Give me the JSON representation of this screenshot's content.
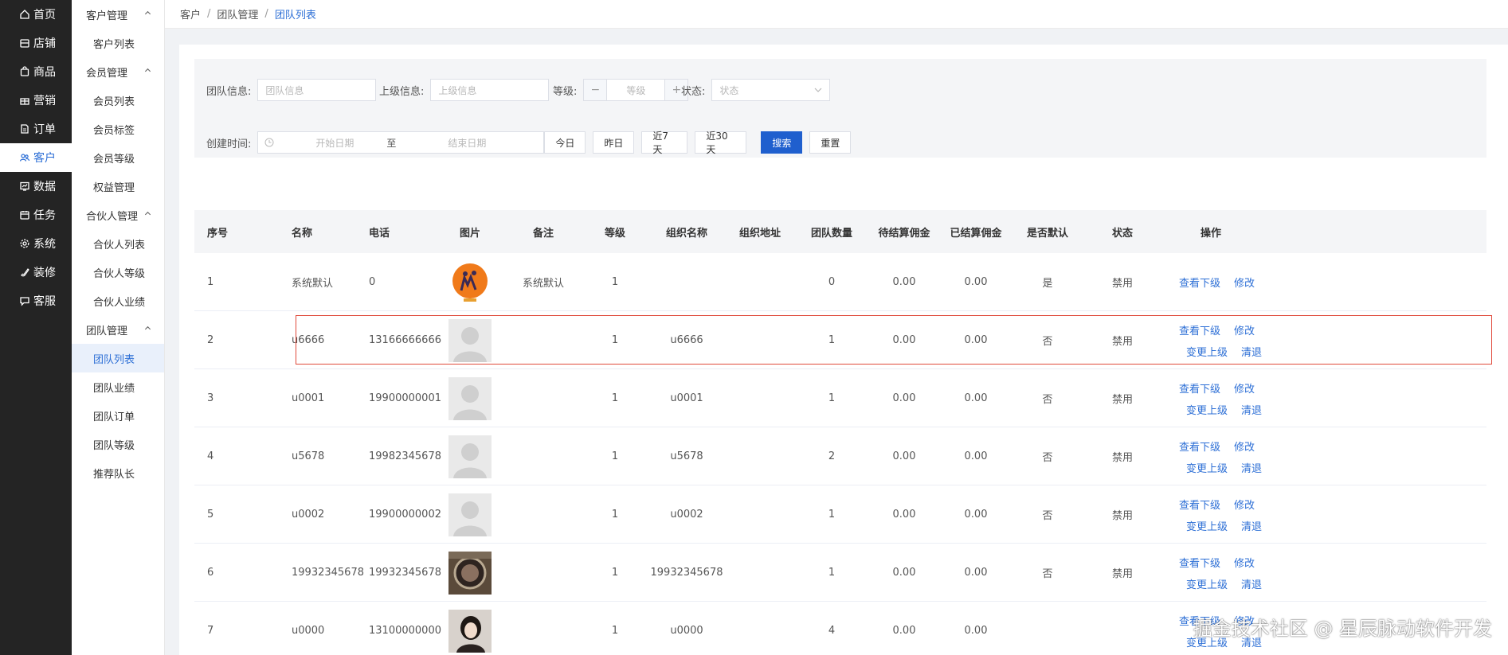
{
  "nav_primary": [
    {
      "label": "首页",
      "icon": "home-icon"
    },
    {
      "label": "店铺",
      "icon": "shop-icon"
    },
    {
      "label": "商品",
      "icon": "bag-icon"
    },
    {
      "label": "营销",
      "icon": "gift-icon"
    },
    {
      "label": "订单",
      "icon": "document-icon"
    },
    {
      "label": "客户",
      "icon": "users-icon",
      "active": true
    },
    {
      "label": "数据",
      "icon": "chart-icon"
    },
    {
      "label": "任务",
      "icon": "calendar-icon"
    },
    {
      "label": "系统",
      "icon": "gear-icon"
    },
    {
      "label": "装修",
      "icon": "brush-icon"
    },
    {
      "label": "客服",
      "icon": "chat-icon"
    }
  ],
  "nav_secondary": [
    {
      "group": "客户管理",
      "items": [
        "客户列表"
      ]
    },
    {
      "group": "会员管理",
      "items": [
        "会员列表",
        "会员标签",
        "会员等级",
        "权益管理"
      ]
    },
    {
      "group": "合伙人管理",
      "items": [
        "合伙人列表",
        "合伙人等级",
        "合伙人业绩"
      ]
    },
    {
      "group": "团队管理",
      "items": [
        "团队列表",
        "团队业绩",
        "团队订单",
        "团队等级",
        "推荐队长"
      ]
    }
  ],
  "breadcrumb": {
    "a": "客户",
    "b": "团队管理",
    "c": "团队列表",
    "sep": "/"
  },
  "filter": {
    "team_label": "团队信息:",
    "team_placeholder": "团队信息",
    "parent_label": "上级信息:",
    "parent_placeholder": "上级信息",
    "level_label": "等级:",
    "level_placeholder": "等级",
    "minus": "−",
    "plus": "+",
    "status_label": "状态:",
    "status_placeholder": "状态",
    "date_label": "创建时间:",
    "start_placeholder": "开始日期",
    "to": "至",
    "end_placeholder": "结束日期",
    "today": "今日",
    "yesterday": "昨日",
    "last7": "近7天",
    "last30": "近30天",
    "search": "搜索",
    "reset": "重置"
  },
  "table": {
    "headers": [
      "序号",
      "名称",
      "电话",
      "图片",
      "备注",
      "等级",
      "组织名称",
      "组织地址",
      "团队数量",
      "待结算佣金",
      "已结算佣金",
      "是否默认",
      "状态",
      "操作"
    ],
    "rows": [
      {
        "no": "1",
        "name": "系统默认",
        "phone": "0",
        "note": "系统默认",
        "level": "1",
        "org": "",
        "addr": "",
        "count": "0",
        "pending": "0.00",
        "settled": "0.00",
        "default": "是",
        "status": "禁用",
        "avatar": "logo"
      },
      {
        "no": "2",
        "name": "u6666",
        "phone": "13166666666",
        "note": "",
        "level": "1",
        "org": "u6666",
        "addr": "",
        "count": "1",
        "pending": "0.00",
        "settled": "0.00",
        "default": "否",
        "status": "禁用",
        "avatar": "placeholder"
      },
      {
        "no": "3",
        "name": "u0001",
        "phone": "19900000001",
        "note": "",
        "level": "1",
        "org": "u0001",
        "addr": "",
        "count": "1",
        "pending": "0.00",
        "settled": "0.00",
        "default": "否",
        "status": "禁用",
        "avatar": "placeholder"
      },
      {
        "no": "4",
        "name": "u5678",
        "phone": "19982345678",
        "note": "",
        "level": "1",
        "org": "u5678",
        "addr": "",
        "count": "2",
        "pending": "0.00",
        "settled": "0.00",
        "default": "否",
        "status": "禁用",
        "avatar": "placeholder"
      },
      {
        "no": "5",
        "name": "u0002",
        "phone": "19900000002",
        "note": "",
        "level": "1",
        "org": "u0002",
        "addr": "",
        "count": "1",
        "pending": "0.00",
        "settled": "0.00",
        "default": "否",
        "status": "禁用",
        "avatar": "placeholder"
      },
      {
        "no": "6",
        "name": "19932345678",
        "phone": "19932345678",
        "note": "",
        "level": "1",
        "org": "19932345678",
        "addr": "",
        "count": "1",
        "pending": "0.00",
        "settled": "0.00",
        "default": "否",
        "status": "禁用",
        "avatar": "photo-bowl"
      },
      {
        "no": "7",
        "name": "u0000",
        "phone": "13100000000",
        "note": "",
        "level": "1",
        "org": "u0000",
        "addr": "",
        "count": "4",
        "pending": "0.00",
        "settled": "0.00",
        "default": "",
        "status": "",
        "avatar": "photo-person"
      }
    ],
    "actions": {
      "view": "查看下级",
      "edit": "修改",
      "change_parent": "变更上级",
      "clear": "清退"
    }
  },
  "watermark": "掘金技术社区 @ 星辰脉动软件开发",
  "colors": {
    "accent": "#2d6fd6",
    "sidebar": "#242424",
    "primary_button": "#1f5fce",
    "highlight": "#e04a3b"
  }
}
